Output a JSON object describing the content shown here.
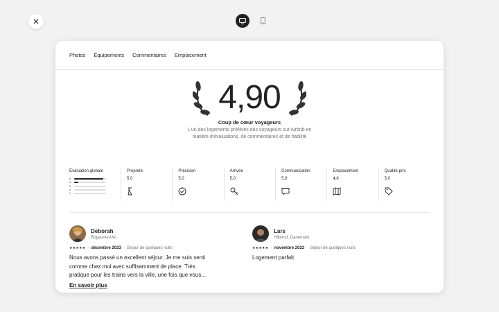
{
  "tabs": [
    "Photos",
    "Équipements",
    "Commentaires",
    "Emplacement"
  ],
  "rating": {
    "score": "4,90",
    "title": "Coup de cœur voyageurs",
    "description": "L'un des logements préférés des voyageurs sur Airbnb en matière d'évaluations, de commentaires et de fiabilité"
  },
  "overall": {
    "label": "Évaluation globale",
    "rows": [
      {
        "n": "5",
        "fraction": 0.92
      },
      {
        "n": "4",
        "fraction": 0.12
      },
      {
        "n": "3",
        "fraction": 0
      },
      {
        "n": "2",
        "fraction": 0
      },
      {
        "n": "1",
        "fraction": 0
      }
    ]
  },
  "categories": [
    {
      "label": "Propreté",
      "value": "5,0",
      "icon": "spray-bottle-icon"
    },
    {
      "label": "Précision",
      "value": "5,0",
      "icon": "check-circle-icon"
    },
    {
      "label": "Arrivée",
      "value": "5,0",
      "icon": "key-icon"
    },
    {
      "label": "Communication",
      "value": "5,0",
      "icon": "chat-bubble-icon"
    },
    {
      "label": "Emplacement",
      "value": "4,8",
      "icon": "map-icon"
    },
    {
      "label": "Qualité-prix",
      "value": "5,0",
      "icon": "price-tag-icon"
    }
  ],
  "reviews": [
    {
      "name": "Deborah",
      "location": "Royaume-Uni",
      "stars": "★★★★★",
      "date": "décembre 2023",
      "stay": "Séjour de quelques nuits",
      "text": "Nous avons passé un excellent séjour. Je me suis senti comme chez moi avec suffisamment de place. Très pratique pour les trains vers la ville, une fois que vous...",
      "more": "En savoir plus"
    },
    {
      "name": "Lars",
      "location": "Hillerod, Danemark",
      "stars": "★★★★★",
      "date": "novembre 2023",
      "stay": "Séjour de quelques nuits",
      "text": "Logement parfait"
    }
  ]
}
